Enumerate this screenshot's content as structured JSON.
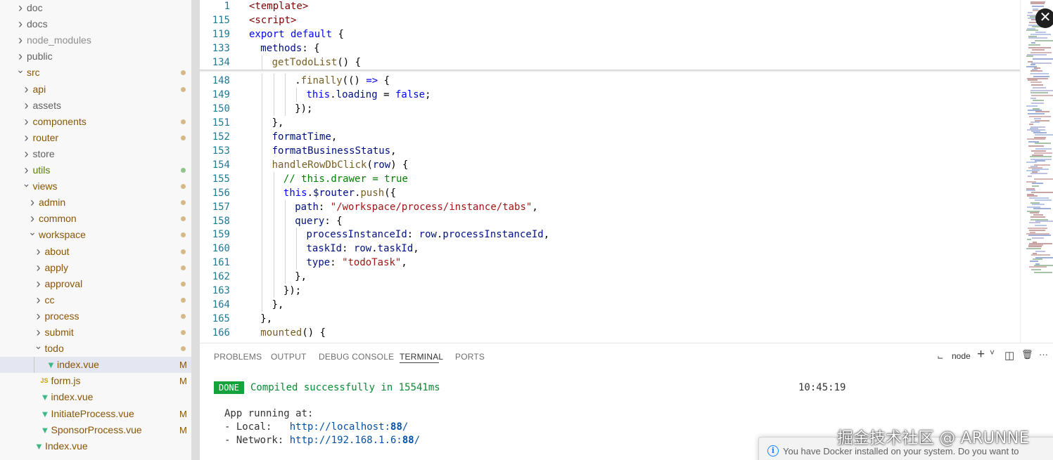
{
  "sidebar": {
    "items": [
      {
        "label": "doc",
        "kind": "folder",
        "state": "closed",
        "depth": 0,
        "tone": "normal",
        "decoration": ""
      },
      {
        "label": "docs",
        "kind": "folder",
        "state": "closed",
        "depth": 0,
        "tone": "normal",
        "decoration": ""
      },
      {
        "label": "node_modules",
        "kind": "folder",
        "state": "closed",
        "depth": 0,
        "tone": "dim",
        "decoration": ""
      },
      {
        "label": "public",
        "kind": "folder",
        "state": "closed",
        "depth": 0,
        "tone": "normal",
        "decoration": ""
      },
      {
        "label": "src",
        "kind": "folder",
        "state": "open",
        "depth": 0,
        "tone": "mod",
        "decoration": "dot"
      },
      {
        "label": "api",
        "kind": "folder",
        "state": "closed",
        "depth": 1,
        "tone": "mod",
        "decoration": "dot"
      },
      {
        "label": "assets",
        "kind": "folder",
        "state": "closed",
        "depth": 1,
        "tone": "normal",
        "decoration": ""
      },
      {
        "label": "components",
        "kind": "folder",
        "state": "closed",
        "depth": 1,
        "tone": "mod",
        "decoration": "dot"
      },
      {
        "label": "router",
        "kind": "folder",
        "state": "closed",
        "depth": 1,
        "tone": "mod",
        "decoration": "dot"
      },
      {
        "label": "store",
        "kind": "folder",
        "state": "closed",
        "depth": 1,
        "tone": "normal",
        "decoration": ""
      },
      {
        "label": "utils",
        "kind": "folder",
        "state": "closed",
        "depth": 1,
        "tone": "green",
        "decoration": "dot-green"
      },
      {
        "label": "views",
        "kind": "folder",
        "state": "open",
        "depth": 1,
        "tone": "mod",
        "decoration": "dot"
      },
      {
        "label": "admin",
        "kind": "folder",
        "state": "closed",
        "depth": 2,
        "tone": "mod",
        "decoration": "dot"
      },
      {
        "label": "common",
        "kind": "folder",
        "state": "closed",
        "depth": 2,
        "tone": "mod",
        "decoration": "dot"
      },
      {
        "label": "workspace",
        "kind": "folder",
        "state": "open",
        "depth": 2,
        "tone": "mod",
        "decoration": "dot"
      },
      {
        "label": "about",
        "kind": "folder",
        "state": "closed",
        "depth": 3,
        "tone": "mod",
        "decoration": "dot"
      },
      {
        "label": "apply",
        "kind": "folder",
        "state": "closed",
        "depth": 3,
        "tone": "mod",
        "decoration": "dot"
      },
      {
        "label": "approval",
        "kind": "folder",
        "state": "closed",
        "depth": 3,
        "tone": "mod",
        "decoration": "dot"
      },
      {
        "label": "cc",
        "kind": "folder",
        "state": "closed",
        "depth": 3,
        "tone": "mod",
        "decoration": "dot"
      },
      {
        "label": "process",
        "kind": "folder",
        "state": "closed",
        "depth": 3,
        "tone": "mod",
        "decoration": "dot"
      },
      {
        "label": "submit",
        "kind": "folder",
        "state": "closed",
        "depth": 3,
        "tone": "mod",
        "decoration": "dot"
      },
      {
        "label": "todo",
        "kind": "folder",
        "state": "open",
        "depth": 3,
        "tone": "mod",
        "decoration": "dot"
      },
      {
        "label": "index.vue",
        "kind": "vue",
        "state": "",
        "depth": 4,
        "tone": "mod",
        "decoration": "M",
        "selected": true
      },
      {
        "label": "form.js",
        "kind": "js",
        "state": "",
        "depth": 3,
        "tone": "mod",
        "decoration": "M"
      },
      {
        "label": "index.vue",
        "kind": "vue",
        "state": "",
        "depth": 3,
        "tone": "mod",
        "decoration": ""
      },
      {
        "label": "InitiateProcess.vue",
        "kind": "vue",
        "state": "",
        "depth": 3,
        "tone": "mod",
        "decoration": "M"
      },
      {
        "label": "SponsorProcess.vue",
        "kind": "vue",
        "state": "",
        "depth": 3,
        "tone": "mod",
        "decoration": "M"
      },
      {
        "label": "Index.vue",
        "kind": "vue",
        "state": "",
        "depth": 2,
        "tone": "mod",
        "decoration": ""
      }
    ]
  },
  "icons": {
    "vue": "vue-file-icon",
    "js": "js-file-icon",
    "folder_closed": "chevron-right-icon",
    "folder_open": "chevron-down-icon"
  },
  "editor": {
    "sticky_lines": [
      {
        "n": "1",
        "indent": 0,
        "tokens": [
          [
            "t-tag",
            "<template>"
          ]
        ]
      },
      {
        "n": "115",
        "indent": 0,
        "tokens": [
          [
            "t-tag",
            "<script>"
          ]
        ]
      },
      {
        "n": "119",
        "indent": 0,
        "tokens": [
          [
            "t-kw",
            "export default"
          ],
          [
            "t-plain",
            " {"
          ]
        ]
      },
      {
        "n": "133",
        "indent": 1,
        "tokens": [
          [
            "t-prop",
            "methods"
          ],
          [
            "t-plain",
            ": {"
          ]
        ]
      },
      {
        "n": "134",
        "indent": 2,
        "tokens": [
          [
            "t-fn",
            "getTodoList"
          ],
          [
            "t-plain",
            "() {"
          ]
        ]
      }
    ],
    "lines": [
      {
        "n": "148",
        "indent": 4,
        "tokens": [
          [
            "t-plain",
            "."
          ],
          [
            "t-fn",
            "finally"
          ],
          [
            "t-plain",
            "(() "
          ],
          [
            "t-kw",
            "=>"
          ],
          [
            "t-plain",
            " {"
          ]
        ]
      },
      {
        "n": "149",
        "indent": 5,
        "tokens": [
          [
            "t-kw",
            "this"
          ],
          [
            "t-plain",
            "."
          ],
          [
            "t-prop",
            "loading"
          ],
          [
            "t-plain",
            " = "
          ],
          [
            "t-kw",
            "false"
          ],
          [
            "t-plain",
            ";"
          ]
        ]
      },
      {
        "n": "150",
        "indent": 4,
        "tokens": [
          [
            "t-plain",
            "});"
          ]
        ]
      },
      {
        "n": "151",
        "indent": 2,
        "tokens": [
          [
            "t-plain",
            "},"
          ]
        ]
      },
      {
        "n": "152",
        "indent": 2,
        "tokens": [
          [
            "t-prop",
            "formatTime"
          ],
          [
            "t-plain",
            ","
          ]
        ]
      },
      {
        "n": "153",
        "indent": 2,
        "tokens": [
          [
            "t-prop",
            "formatBusinessStatus"
          ],
          [
            "t-plain",
            ","
          ]
        ]
      },
      {
        "n": "154",
        "indent": 2,
        "tokens": [
          [
            "t-fn",
            "handleRowDbClick"
          ],
          [
            "t-plain",
            "("
          ],
          [
            "t-prop",
            "row"
          ],
          [
            "t-plain",
            ") {"
          ]
        ]
      },
      {
        "n": "155",
        "indent": 3,
        "tokens": [
          [
            "t-com",
            "// this.drawer = true"
          ]
        ]
      },
      {
        "n": "156",
        "indent": 3,
        "tokens": [
          [
            "t-kw",
            "this"
          ],
          [
            "t-plain",
            "."
          ],
          [
            "t-prop",
            "$router"
          ],
          [
            "t-plain",
            "."
          ],
          [
            "t-fn",
            "push"
          ],
          [
            "t-plain",
            "({"
          ]
        ]
      },
      {
        "n": "157",
        "indent": 4,
        "tokens": [
          [
            "t-prop",
            "path"
          ],
          [
            "t-plain",
            ": "
          ],
          [
            "t-str",
            "\"/workspace/process/instance/tabs\""
          ],
          [
            "t-plain",
            ","
          ]
        ]
      },
      {
        "n": "158",
        "indent": 4,
        "tokens": [
          [
            "t-prop",
            "query"
          ],
          [
            "t-plain",
            ": {"
          ]
        ]
      },
      {
        "n": "159",
        "indent": 5,
        "tokens": [
          [
            "t-prop",
            "processInstanceId"
          ],
          [
            "t-plain",
            ": "
          ],
          [
            "t-prop",
            "row"
          ],
          [
            "t-plain",
            "."
          ],
          [
            "t-prop",
            "processInstanceId"
          ],
          [
            "t-plain",
            ","
          ]
        ]
      },
      {
        "n": "160",
        "indent": 5,
        "tokens": [
          [
            "t-prop",
            "taskId"
          ],
          [
            "t-plain",
            ": "
          ],
          [
            "t-prop",
            "row"
          ],
          [
            "t-plain",
            "."
          ],
          [
            "t-prop",
            "taskId"
          ],
          [
            "t-plain",
            ","
          ]
        ]
      },
      {
        "n": "161",
        "indent": 5,
        "tokens": [
          [
            "t-prop",
            "type"
          ],
          [
            "t-plain",
            ": "
          ],
          [
            "t-str",
            "\"todoTask\""
          ],
          [
            "t-plain",
            ","
          ]
        ]
      },
      {
        "n": "162",
        "indent": 4,
        "tokens": [
          [
            "t-plain",
            "},"
          ]
        ]
      },
      {
        "n": "163",
        "indent": 3,
        "tokens": [
          [
            "t-plain",
            "});"
          ]
        ]
      },
      {
        "n": "164",
        "indent": 2,
        "tokens": [
          [
            "t-plain",
            "},"
          ]
        ]
      },
      {
        "n": "165",
        "indent": 1,
        "tokens": [
          [
            "t-plain",
            "},"
          ]
        ]
      },
      {
        "n": "166",
        "indent": 1,
        "tokens": [
          [
            "t-fn",
            "mounted"
          ],
          [
            "t-plain",
            "() {"
          ]
        ]
      }
    ]
  },
  "panel": {
    "tabs": [
      {
        "label": "PROBLEMS"
      },
      {
        "label": "OUTPUT"
      },
      {
        "label": "DEBUG CONSOLE"
      },
      {
        "label": "TERMINAL"
      },
      {
        "label": "PORTS"
      }
    ],
    "active_tab": "TERMINAL",
    "terminal_name": "node",
    "actions": {
      "new_terminal": "+",
      "dropdown": "˅",
      "split": "◫",
      "trash": "🗑",
      "more": "···"
    },
    "terminal": {
      "done_label": "DONE",
      "compiled_text": "Compiled successfully in 15541ms",
      "time": "10:45:19",
      "running_text": "App running at:",
      "local_label": "- Local:   ",
      "local_url_base": "http://localhost:",
      "local_port": "88",
      "local_url_tail": "/",
      "network_label": "- Network: ",
      "network_url_base": "http://192.168.1.6:",
      "network_port": "88",
      "network_url_tail": "/"
    }
  },
  "notification": {
    "text": "You have Docker installed on your system. Do you want to",
    "icon": "info-icon"
  },
  "watermark": "掘金技术社区 @ ARUNNE",
  "close_glyph": "✕"
}
